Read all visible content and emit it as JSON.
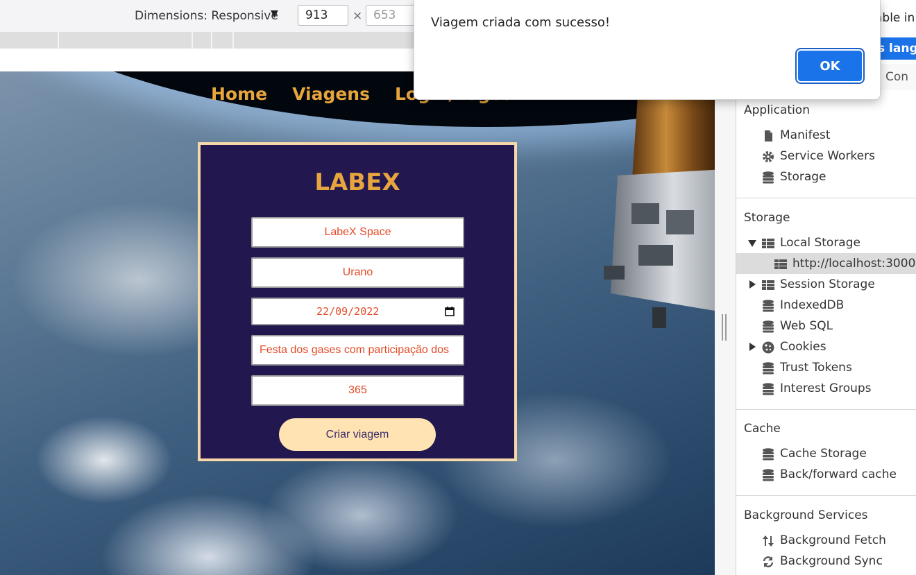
{
  "device_toolbar": {
    "dimensions_label": "Dimensions: Responsive",
    "dropdown_arrow": "▼",
    "width_value": "913",
    "times_symbol": "×",
    "height_value": "653"
  },
  "app": {
    "nav": [
      "Home",
      "Viagens",
      "Login/Logout"
    ],
    "title": "LABEX",
    "form": {
      "name": "LabeX Space",
      "planet": "Urano",
      "date": "22/09/2022",
      "description": "Festa dos gases com participação dos",
      "duration": "365",
      "submit_label": "Criar viagem"
    },
    "colors": {
      "accent": "#e7a53e",
      "card_bg": "#22174f",
      "field_text": "#e44a27",
      "button_bg": "#ffe3b2"
    }
  },
  "alert": {
    "message": "Viagem criada com sucesso!",
    "ok_label": "OK"
  },
  "devtools": {
    "partial_top_text": "able in",
    "partial_blue_text": "s langu",
    "partial_tab": "Con",
    "sections": {
      "application": {
        "title": "Application",
        "items": [
          {
            "label": "Manifest",
            "icon": "document-icon"
          },
          {
            "label": "Service Workers",
            "icon": "gear-icon"
          },
          {
            "label": "Storage",
            "icon": "database-icon"
          }
        ]
      },
      "storage": {
        "title": "Storage",
        "items": [
          {
            "label": "Local Storage",
            "icon": "grid-icon"
          },
          {
            "label": "http://localhost:3000",
            "icon": "grid-icon"
          },
          {
            "label": "Session Storage",
            "icon": "grid-icon"
          },
          {
            "label": "IndexedDB",
            "icon": "database-icon"
          },
          {
            "label": "Web SQL",
            "icon": "database-icon"
          },
          {
            "label": "Cookies",
            "icon": "cookie-icon"
          },
          {
            "label": "Trust Tokens",
            "icon": "database-icon"
          },
          {
            "label": "Interest Groups",
            "icon": "database-icon"
          }
        ]
      },
      "cache": {
        "title": "Cache",
        "items": [
          {
            "label": "Cache Storage",
            "icon": "database-icon"
          },
          {
            "label": "Back/forward cache",
            "icon": "database-icon"
          }
        ]
      },
      "background_services": {
        "title": "Background Services",
        "items": [
          {
            "label": "Background Fetch",
            "icon": "up-down-arrows-icon"
          },
          {
            "label": "Background Sync",
            "icon": "sync-icon"
          }
        ]
      }
    }
  }
}
